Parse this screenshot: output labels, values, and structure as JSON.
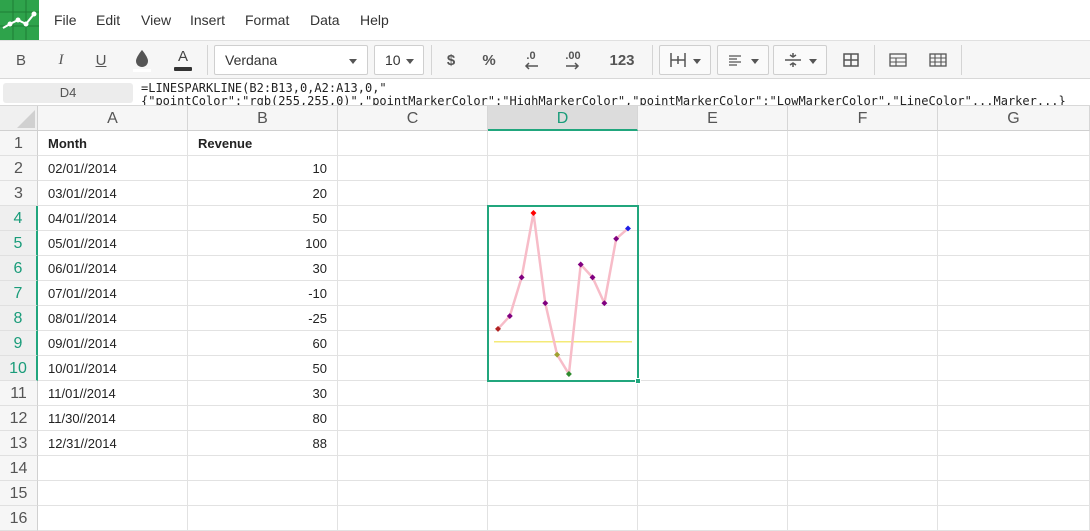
{
  "menu": {
    "items": [
      "File",
      "Edit",
      "View",
      "Insert",
      "Format",
      "Data",
      "Help"
    ]
  },
  "toolbar": {
    "bold": "B",
    "italic": "I",
    "underline": "U",
    "font_color_glyph": "A",
    "font_name": "Verdana",
    "font_size": "10",
    "currency": "$",
    "percent": "%",
    "decrease_decimals": ".0",
    "increase_decimals": ".00",
    "number_format": "123"
  },
  "formula_bar": {
    "cell_ref": "D4",
    "formula_line1": "=LINESPARKLINE(B2:B13,0,A2:A13,0,\"",
    "formula_line2": "{\"pointColor\":\"rgb(255,255,0)\",\"pointMarkerColor\":\"HighMarkerColor\",\"pointMarkerColor\":\"LowMarkerColor\",\"LineColor\"...Marker...}"
  },
  "columns": [
    "A",
    "B",
    "C",
    "D",
    "E",
    "F",
    "G"
  ],
  "active_column": "D",
  "rows": [
    "1",
    "2",
    "3",
    "4",
    "5",
    "6",
    "7",
    "8",
    "9",
    "10",
    "11",
    "12",
    "13",
    "14",
    "15",
    "16"
  ],
  "active_rows": [
    "4",
    "5",
    "6",
    "7",
    "8",
    "9",
    "10"
  ],
  "table": {
    "header": [
      "Month",
      "Revenue"
    ],
    "data": [
      [
        "02/01//2014",
        "10"
      ],
      [
        "03/01//2014",
        "20"
      ],
      [
        "04/01//2014",
        "50"
      ],
      [
        "05/01//2014",
        "100"
      ],
      [
        "06/01//2014",
        "30"
      ],
      [
        "07/01//2014",
        "-10"
      ],
      [
        "08/01//2014",
        "-25"
      ],
      [
        "09/01//2014",
        "60"
      ],
      [
        "10/01//2014",
        "50"
      ],
      [
        "11/01//2014",
        "30"
      ],
      [
        "11/30//2014",
        "80"
      ],
      [
        "12/31//2014",
        "88"
      ]
    ]
  },
  "sparkline": {
    "values": [
      10,
      20,
      50,
      100,
      30,
      -10,
      -25,
      60,
      50,
      30,
      80,
      88
    ],
    "axis_value": 0,
    "colors": {
      "line": "#f7bcc8",
      "axis": "#f1e34a",
      "marker": "#800080",
      "high": "#ff0000",
      "low": "#2e8b2e",
      "first": "#b22222",
      "last": "#1e1ee6",
      "negative": "#a0a030"
    }
  }
}
